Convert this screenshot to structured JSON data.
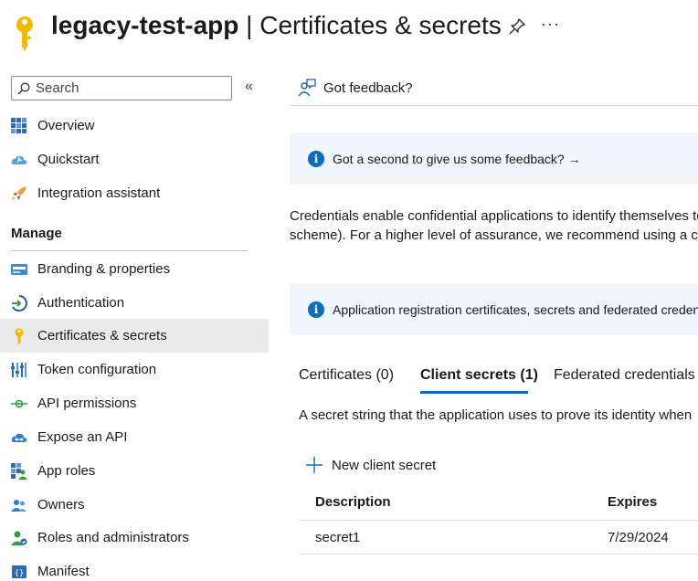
{
  "header": {
    "app_name": "legacy-test-app",
    "separator": " | ",
    "page_name": "Certificates & secrets",
    "more_label": "···"
  },
  "sidebar": {
    "search_placeholder": "Search",
    "collapse_label": "«",
    "items_top": [
      {
        "label": "Overview",
        "icon": "overview-grid-icon"
      },
      {
        "label": "Quickstart",
        "icon": "quickstart-cloud-icon"
      },
      {
        "label": "Integration assistant",
        "icon": "rocket-icon"
      }
    ],
    "section_label": "Manage",
    "items_manage": [
      {
        "label": "Branding & properties",
        "icon": "branding-icon"
      },
      {
        "label": "Authentication",
        "icon": "authentication-icon"
      },
      {
        "label": "Certificates & secrets",
        "icon": "key-icon",
        "active": true
      },
      {
        "label": "Token configuration",
        "icon": "token-bars-icon"
      },
      {
        "label": "API permissions",
        "icon": "api-permissions-icon"
      },
      {
        "label": "Expose an API",
        "icon": "expose-api-cloud-icon"
      },
      {
        "label": "App roles",
        "icon": "app-roles-icon"
      },
      {
        "label": "Owners",
        "icon": "owners-icon"
      },
      {
        "label": "Roles and administrators",
        "icon": "roles-admin-icon"
      },
      {
        "label": "Manifest",
        "icon": "manifest-icon"
      }
    ]
  },
  "main": {
    "feedback_label": "Got feedback?",
    "info_feedback": "Got a second to give us some feedback? →",
    "description_line1": "Credentials enable confidential applications to identify themselves to",
    "description_line2": "scheme). For a higher level of assurance, we recommend using a cer",
    "info_registration": "Application registration certificates, secrets and federated credent",
    "tabs": [
      {
        "label": "Certificates (0)"
      },
      {
        "label": "Client secrets (1)",
        "active": true
      },
      {
        "label": "Federated credentials"
      }
    ],
    "tab_description": "A secret string that the application uses to prove its identity when",
    "new_secret_label": "New client secret",
    "table": {
      "columns": [
        "Description",
        "Expires"
      ],
      "rows": [
        {
          "description": "secret1",
          "expires": "7/29/2024"
        }
      ]
    }
  },
  "colors": {
    "accent": "#0f6cbd",
    "info_background": "#eff6fc",
    "active_nav": "#ebebeb",
    "key_yellow": "#f5b800"
  }
}
